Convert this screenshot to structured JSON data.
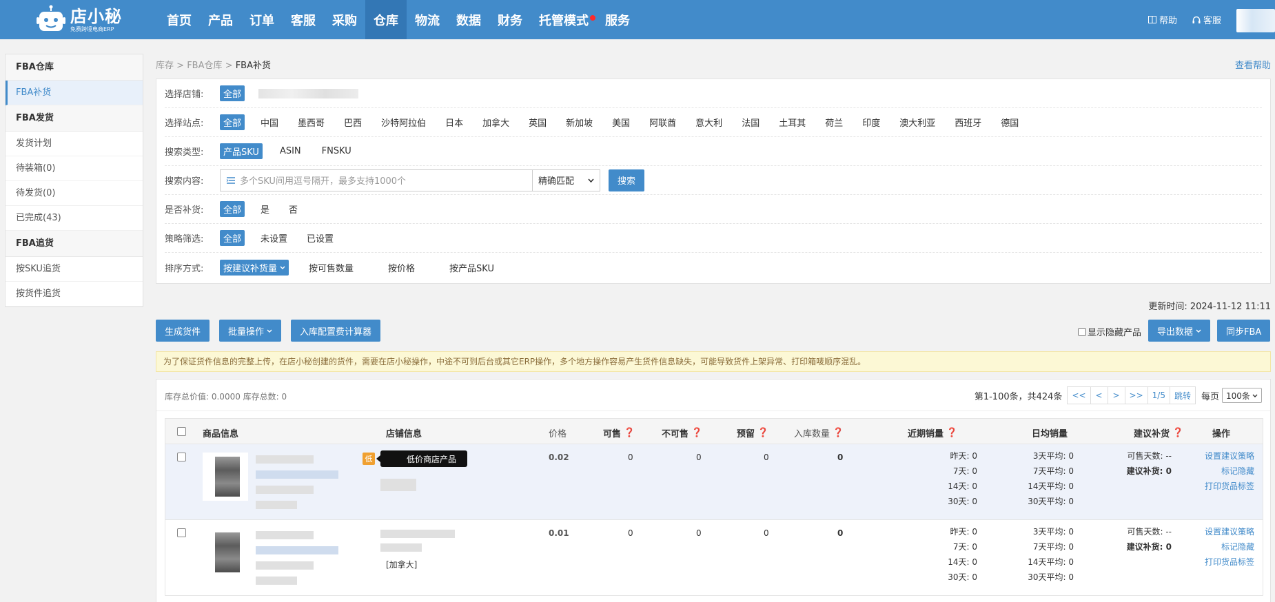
{
  "header": {
    "logo_name": "店小秘",
    "logo_sub": "免费跨境电商ERP",
    "nav": [
      {
        "label": "首页"
      },
      {
        "label": "产品"
      },
      {
        "label": "订单"
      },
      {
        "label": "客服"
      },
      {
        "label": "采购"
      },
      {
        "label": "仓库"
      },
      {
        "label": "物流"
      },
      {
        "label": "数据"
      },
      {
        "label": "财务"
      },
      {
        "label": "托管模式"
      },
      {
        "label": "服务"
      }
    ],
    "active_nav": "仓库",
    "help": "帮助",
    "service": "客服",
    "brand_color": "#428bca",
    "icons": {
      "help": "book-icon",
      "service": "headset-icon"
    }
  },
  "sidebar": {
    "groups": [
      {
        "title": "FBA仓库",
        "items": [
          "FBA补货"
        ]
      },
      {
        "title": "FBA发货",
        "items": [
          "发货计划",
          "待装箱(0)",
          "待发货(0)",
          "已完成(43)"
        ]
      },
      {
        "title": "FBA追货",
        "items": [
          "按SKU追货",
          "按货件追货"
        ]
      }
    ],
    "active_item": "FBA补货"
  },
  "breadcrumb": {
    "items": [
      "库存",
      "FBA仓库"
    ],
    "current": "FBA补货",
    "sep": ">",
    "help": "查看帮助"
  },
  "filters": {
    "shop": {
      "label": "选择店铺:",
      "options": [
        "全部"
      ]
    },
    "site": {
      "label": "选择站点:",
      "options": [
        "全部",
        "中国",
        "墨西哥",
        "巴西",
        "沙特阿拉伯",
        "日本",
        "加拿大",
        "英国",
        "新加坡",
        "美国",
        "阿联酋",
        "意大利",
        "法国",
        "土耳其",
        "荷兰",
        "印度",
        "澳大利亚",
        "西班牙",
        "德国"
      ]
    },
    "search_type": {
      "label": "搜索类型:",
      "options": [
        "产品SKU",
        "ASIN",
        "FNSKU"
      ]
    },
    "search_content": {
      "label": "搜索内容:",
      "placeholder": "多个SKU间用逗号隔开，最多支持1000个",
      "match": "精确匹配",
      "button": "搜索"
    },
    "replenish": {
      "label": "是否补货:",
      "options": [
        "全部",
        "是",
        "否"
      ]
    },
    "strategy": {
      "label": "策略筛选:",
      "options": [
        "全部",
        "未设置",
        "已设置"
      ]
    },
    "sort": {
      "label": "排序方式:",
      "options": [
        "按建议补货量",
        "按可售数量",
        "按价格",
        "按产品SKU"
      ]
    }
  },
  "update_time": "更新时间: 2024-11-12 11:11",
  "actions": {
    "generate": "生成货件",
    "batch": "批量操作",
    "calculator": "入库配置费计算器",
    "show_hidden": "显示隐藏产品",
    "export": "导出数据",
    "sync": "同步FBA"
  },
  "notice": "为了保证货件信息的完整上传，在店小秘创建的货件，需要在店小秘操作，中途不可到后台或其它ERP操作，多个地方操作容易产生货件信息缺失，可能导致货件上架异常、打印箱唛顺序混乱。",
  "stats": "库存总价值: 0.0000 库存总数: 0",
  "pager": {
    "info": "第1-100条，共424条",
    "first": "<<",
    "prev": "<",
    "next": ">",
    "last": ">>",
    "page": "1/5",
    "jump": "跳转",
    "per_label": "每页",
    "per_value": "100条"
  },
  "table": {
    "headers": {
      "product": "商品信息",
      "shop": "店铺信息",
      "price": "价格",
      "sellable": "可售",
      "unsellable": "不可售",
      "reserved": "预留",
      "inbound": "入库数量",
      "recent": "近期销量",
      "daily": "日均销量",
      "suggest": "建议补货",
      "ops": "操作"
    },
    "rows": [
      {
        "badge": "低",
        "tooltip": "低价商店产品",
        "shop_site": "",
        "price": "0.02",
        "sellable": "0",
        "unsellable": "0",
        "reserved": "0",
        "inbound": "0",
        "recent": [
          "昨天: 0",
          "7天: 0",
          "14天: 0",
          "30天: 0"
        ],
        "daily": [
          "3天平均: 0",
          "7天平均: 0",
          "14天平均: 0",
          "30天平均: 0"
        ],
        "suggest_days": "可售天数: --",
        "suggest_qty": "建议补货: 0",
        "ops": [
          "设置建议策略",
          "标记隐藏",
          "打印货品标签"
        ]
      },
      {
        "badge": "",
        "tooltip": "",
        "shop_site": "[加拿大]",
        "price": "0.01",
        "sellable": "0",
        "unsellable": "0",
        "reserved": "0",
        "inbound": "0",
        "recent": [
          "昨天: 0",
          "7天: 0",
          "14天: 0",
          "30天: 0"
        ],
        "daily": [
          "3天平均: 0",
          "7天平均: 0",
          "14天平均: 0",
          "30天平均: 0"
        ],
        "suggest_days": "可售天数: --",
        "suggest_qty": "建议补货: 0",
        "ops": [
          "设置建议策略",
          "标记隐藏",
          "打印货品标签"
        ]
      }
    ]
  }
}
